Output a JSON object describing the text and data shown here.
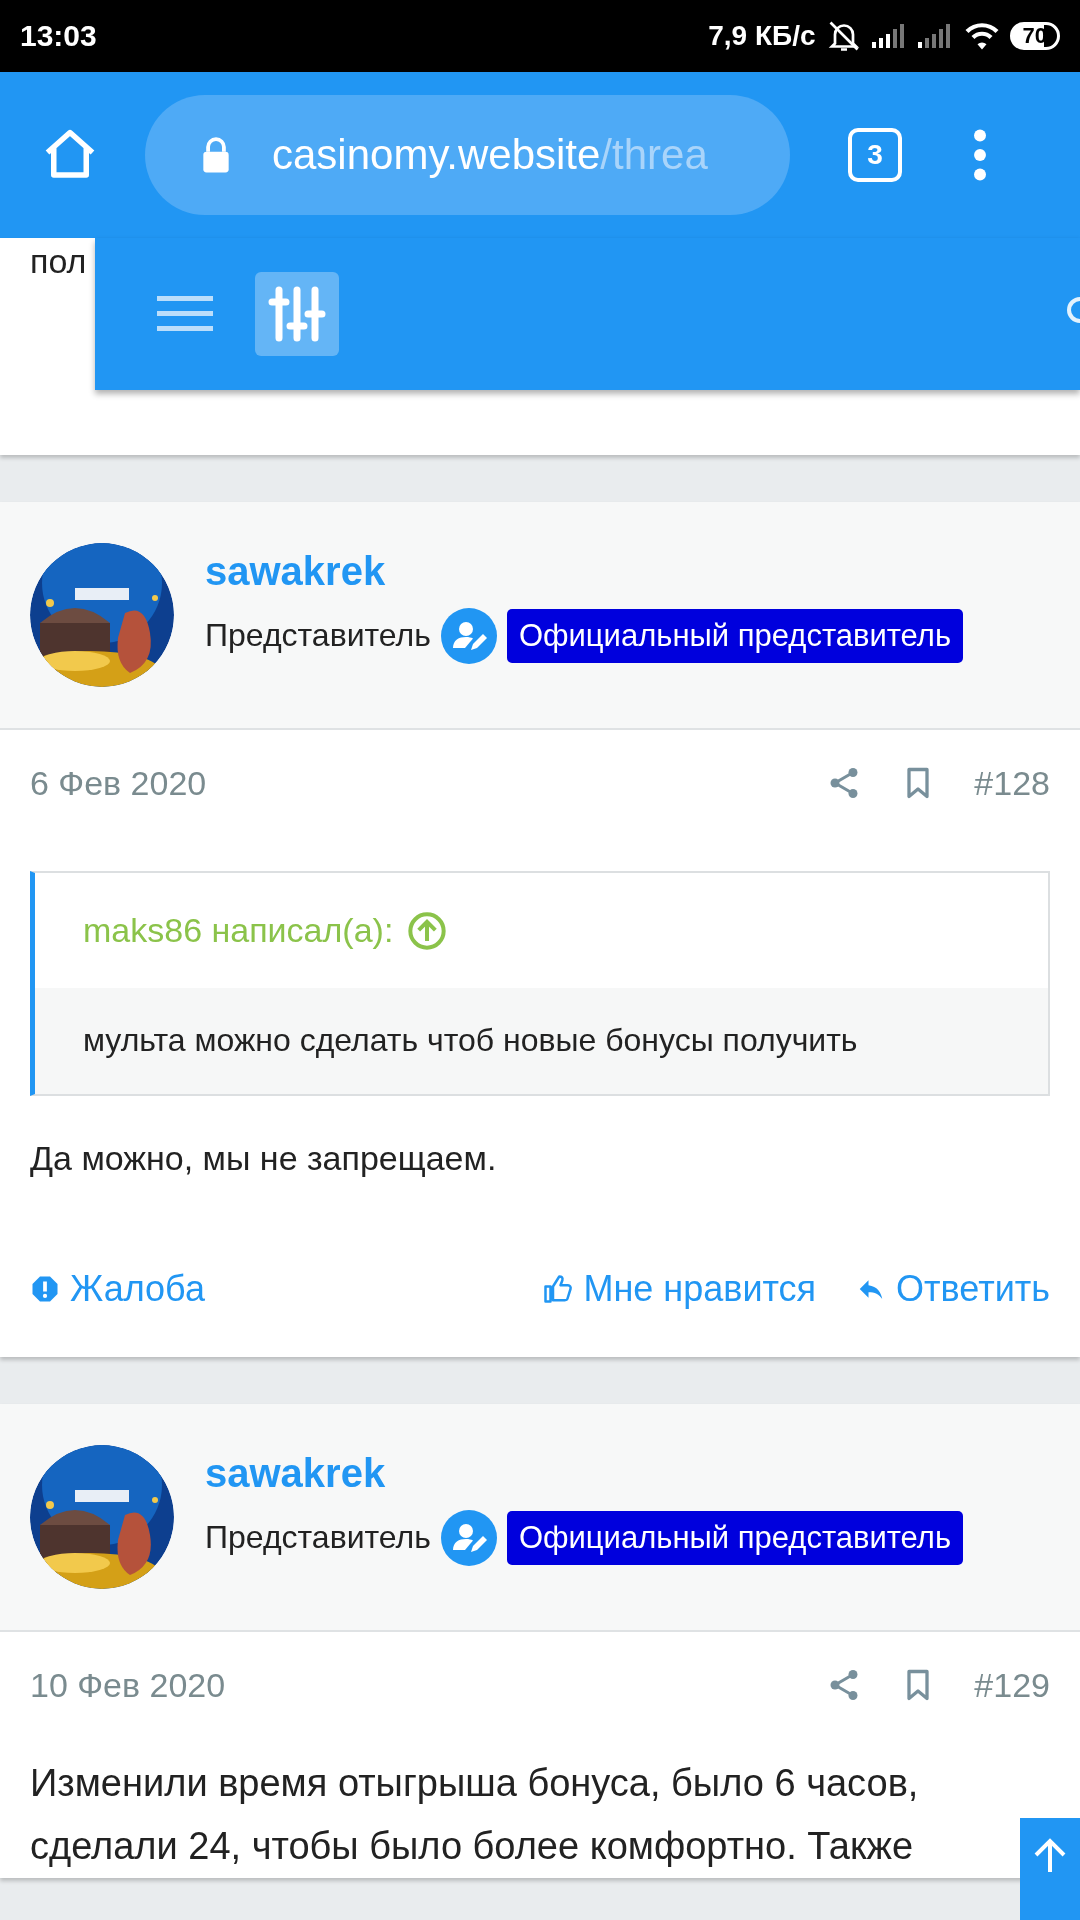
{
  "status_bar": {
    "time": "13:03",
    "net_speed": "7,9 КБ/с",
    "battery": "70"
  },
  "browser": {
    "url_host": "casinomy.website",
    "url_path": "/threa",
    "tab_count": "3"
  },
  "previous_post": {
    "body": "пол"
  },
  "posts": [
    {
      "author": "sawakrek",
      "role": "Представитель",
      "badge": "Официальный представитель",
      "date": "6 Фев 2020",
      "number": "#128",
      "quote": {
        "title": "maks86 написал(а):",
        "text": "мульта можно сделать чтоб новые бонусы получить"
      },
      "body": "Да можно, мы не запрещаем.",
      "actions": [
        {
          "kind": "report",
          "label": "Жалоба"
        },
        {
          "kind": "like",
          "label": "Мне нравится"
        },
        {
          "kind": "reply",
          "label": "Ответить"
        }
      ]
    },
    {
      "author": "sawakrek",
      "role": "Представитель",
      "badge": "Официальный представитель",
      "date": "10 Фев 2020",
      "number": "#129",
      "body": "Изменили время отыгрыша бонуса, было 6 часов, сделали 24, чтобы было более комфортно. Также"
    }
  ]
}
